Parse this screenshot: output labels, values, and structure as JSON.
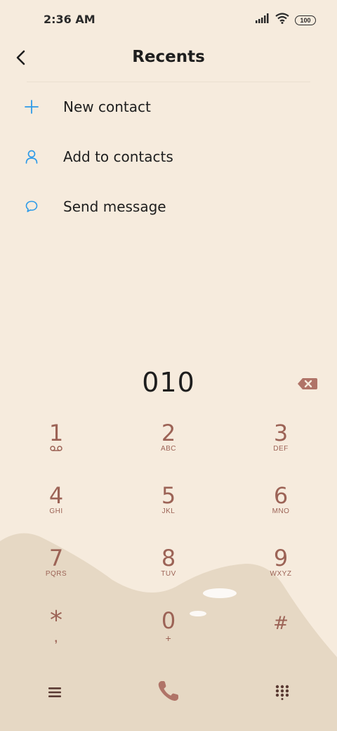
{
  "status_bar": {
    "time": "2:36 AM",
    "battery": "100"
  },
  "header": {
    "title": "Recents"
  },
  "menu": {
    "items": [
      {
        "label": "New contact",
        "icon": "plus-icon"
      },
      {
        "label": "Add to contacts",
        "icon": "person-icon"
      },
      {
        "label": "Send message",
        "icon": "message-bubble-icon"
      }
    ]
  },
  "dialer": {
    "number": "010",
    "keys": [
      {
        "digit": "1",
        "letters": "voicemail-icon"
      },
      {
        "digit": "2",
        "letters": "ABC"
      },
      {
        "digit": "3",
        "letters": "DEF"
      },
      {
        "digit": "4",
        "letters": "GHI"
      },
      {
        "digit": "5",
        "letters": "JKL"
      },
      {
        "digit": "6",
        "letters": "MNO"
      },
      {
        "digit": "7",
        "letters": "PQRS"
      },
      {
        "digit": "8",
        "letters": "TUV"
      },
      {
        "digit": "9",
        "letters": "WXYZ"
      },
      {
        "digit": "*",
        "letters": ","
      },
      {
        "digit": "0",
        "letters": "+"
      },
      {
        "digit": "#",
        "letters": ""
      }
    ]
  },
  "colors": {
    "background": "#f6ebdd",
    "accent_blue": "#2e9be8",
    "key_text": "#9c6356",
    "wave": "#e6d8c4"
  }
}
